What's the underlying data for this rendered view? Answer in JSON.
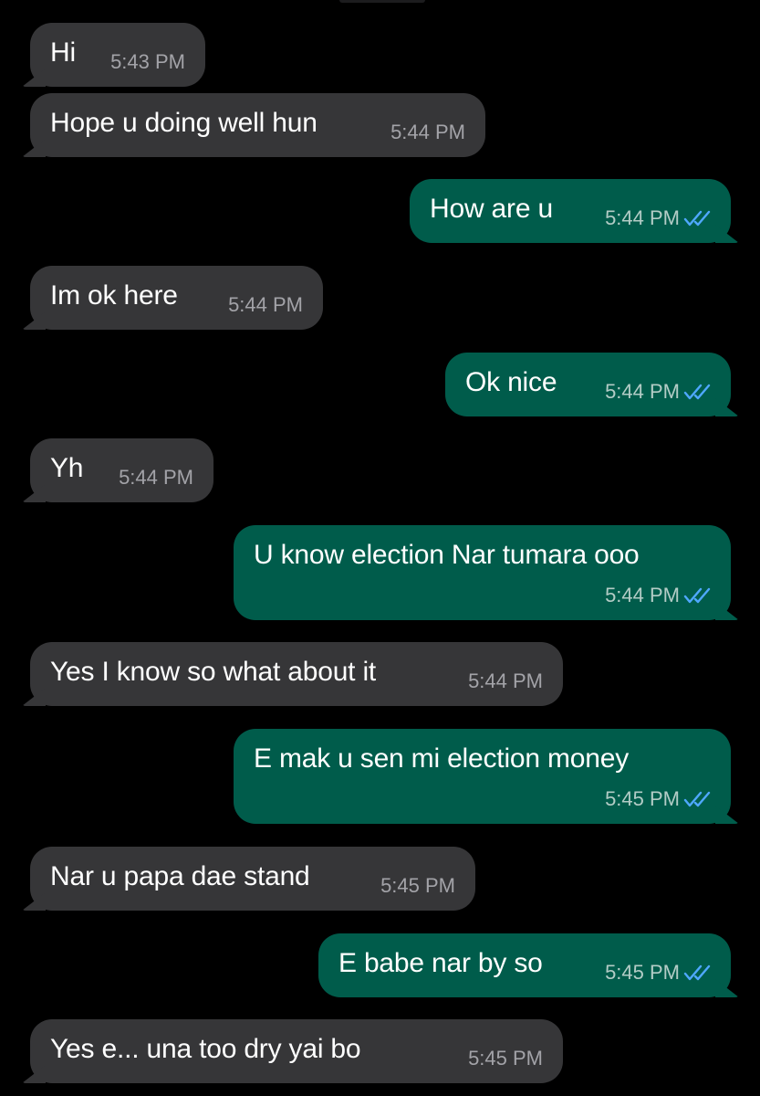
{
  "conversation": {
    "messages": [
      {
        "direction": "incoming",
        "text": "Hi",
        "time": "5:43 PM"
      },
      {
        "direction": "incoming",
        "text": "Hope u doing well hun",
        "time": "5:44 PM"
      },
      {
        "direction": "outgoing",
        "text": "How are u",
        "time": "5:44 PM",
        "status_icon": "double-check-icon"
      },
      {
        "direction": "incoming",
        "text": "Im ok here",
        "time": "5:44 PM"
      },
      {
        "direction": "outgoing",
        "text": "Ok nice",
        "time": "5:44 PM",
        "status_icon": "double-check-icon"
      },
      {
        "direction": "incoming",
        "text": "Yh",
        "time": "5:44 PM"
      },
      {
        "direction": "outgoing",
        "text": "U know election Nar tumara ooo",
        "time": "5:44 PM",
        "status_icon": "double-check-icon"
      },
      {
        "direction": "incoming",
        "text": "Yes I know so what about it",
        "time": "5:44 PM"
      },
      {
        "direction": "outgoing",
        "text": "E mak u sen mi election money",
        "time": "5:45 PM",
        "status_icon": "double-check-icon"
      },
      {
        "direction": "incoming",
        "text": "Nar u papa dae stand",
        "time": "5:45 PM"
      },
      {
        "direction": "outgoing",
        "text": "E babe nar by so",
        "time": "5:45 PM",
        "status_icon": "double-check-icon"
      },
      {
        "direction": "incoming",
        "text": "Yes e... una too dry yai bo",
        "time": "5:45 PM"
      }
    ]
  },
  "colors": {
    "background": "#000000",
    "incoming_bubble": "#363638",
    "outgoing_bubble": "#005c4b",
    "read_ticks": "#4fa8ff",
    "incoming_time": "#a3a3a8",
    "outgoing_time": "#b3ccc6"
  }
}
